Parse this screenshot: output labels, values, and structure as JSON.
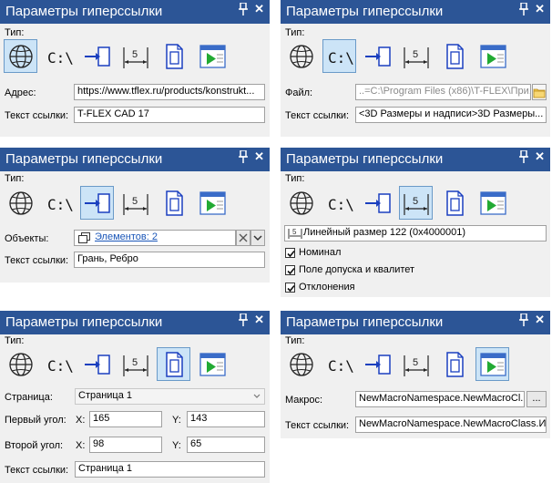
{
  "panel_title": "Параметры гиперссылки",
  "type_label": "Тип:",
  "icons": [
    "globe-icon",
    "drive-path-icon",
    "object-arrow-icon",
    "dimension-icon",
    "page-icon",
    "macro-window-icon"
  ],
  "panels": [
    {
      "selected": 0,
      "address_label": "Адрес:",
      "address_value": "https://www.tflex.ru/products/konstrukt...",
      "link_text_label": "Текст ссылки:",
      "link_text_value": "T-FLEX CAD 17"
    },
    {
      "selected": 1,
      "file_label": "Файл:",
      "file_value": "..=C:\\Program Files (x86)\\T-FLEX\\При...",
      "link_text_label": "Текст ссылки:",
      "link_text_value": "<3D Размеры и надписи>3D Размеры..."
    },
    {
      "selected": 2,
      "objects_label": "Объекты:",
      "objects_value": "Элементов: 2",
      "link_text_label": "Текст ссылки:",
      "link_text_value": "Грань, Ребро"
    },
    {
      "selected": 3,
      "dimension_value": "Линейный размер 122 (0x4000001)",
      "checkboxes": [
        {
          "label": "Номинал",
          "checked": true
        },
        {
          "label": "Поле допуска и квалитет",
          "checked": true
        },
        {
          "label": "Отклонения",
          "checked": true
        }
      ]
    },
    {
      "selected": 4,
      "page_label": "Страница:",
      "page_value": "Страница 1",
      "first_corner_label": "Первый угол:",
      "first_x_label": "X:",
      "first_x": "165",
      "first_y_label": "Y:",
      "first_y": "143",
      "second_corner_label": "Второй угол:",
      "second_x_label": "X:",
      "second_x": "98",
      "second_y_label": "Y:",
      "second_y": "65",
      "link_text_label": "Текст ссылки:",
      "link_text_value": "Страница 1"
    },
    {
      "selected": 5,
      "macro_label": "Макрос:",
      "macro_value": "NewMacroNamespace.NewMacroCl...",
      "browse_label": "...",
      "link_text_label": "Текст ссылки:",
      "link_text_value": "NewMacroNamespace.NewMacroClass.И..."
    }
  ]
}
